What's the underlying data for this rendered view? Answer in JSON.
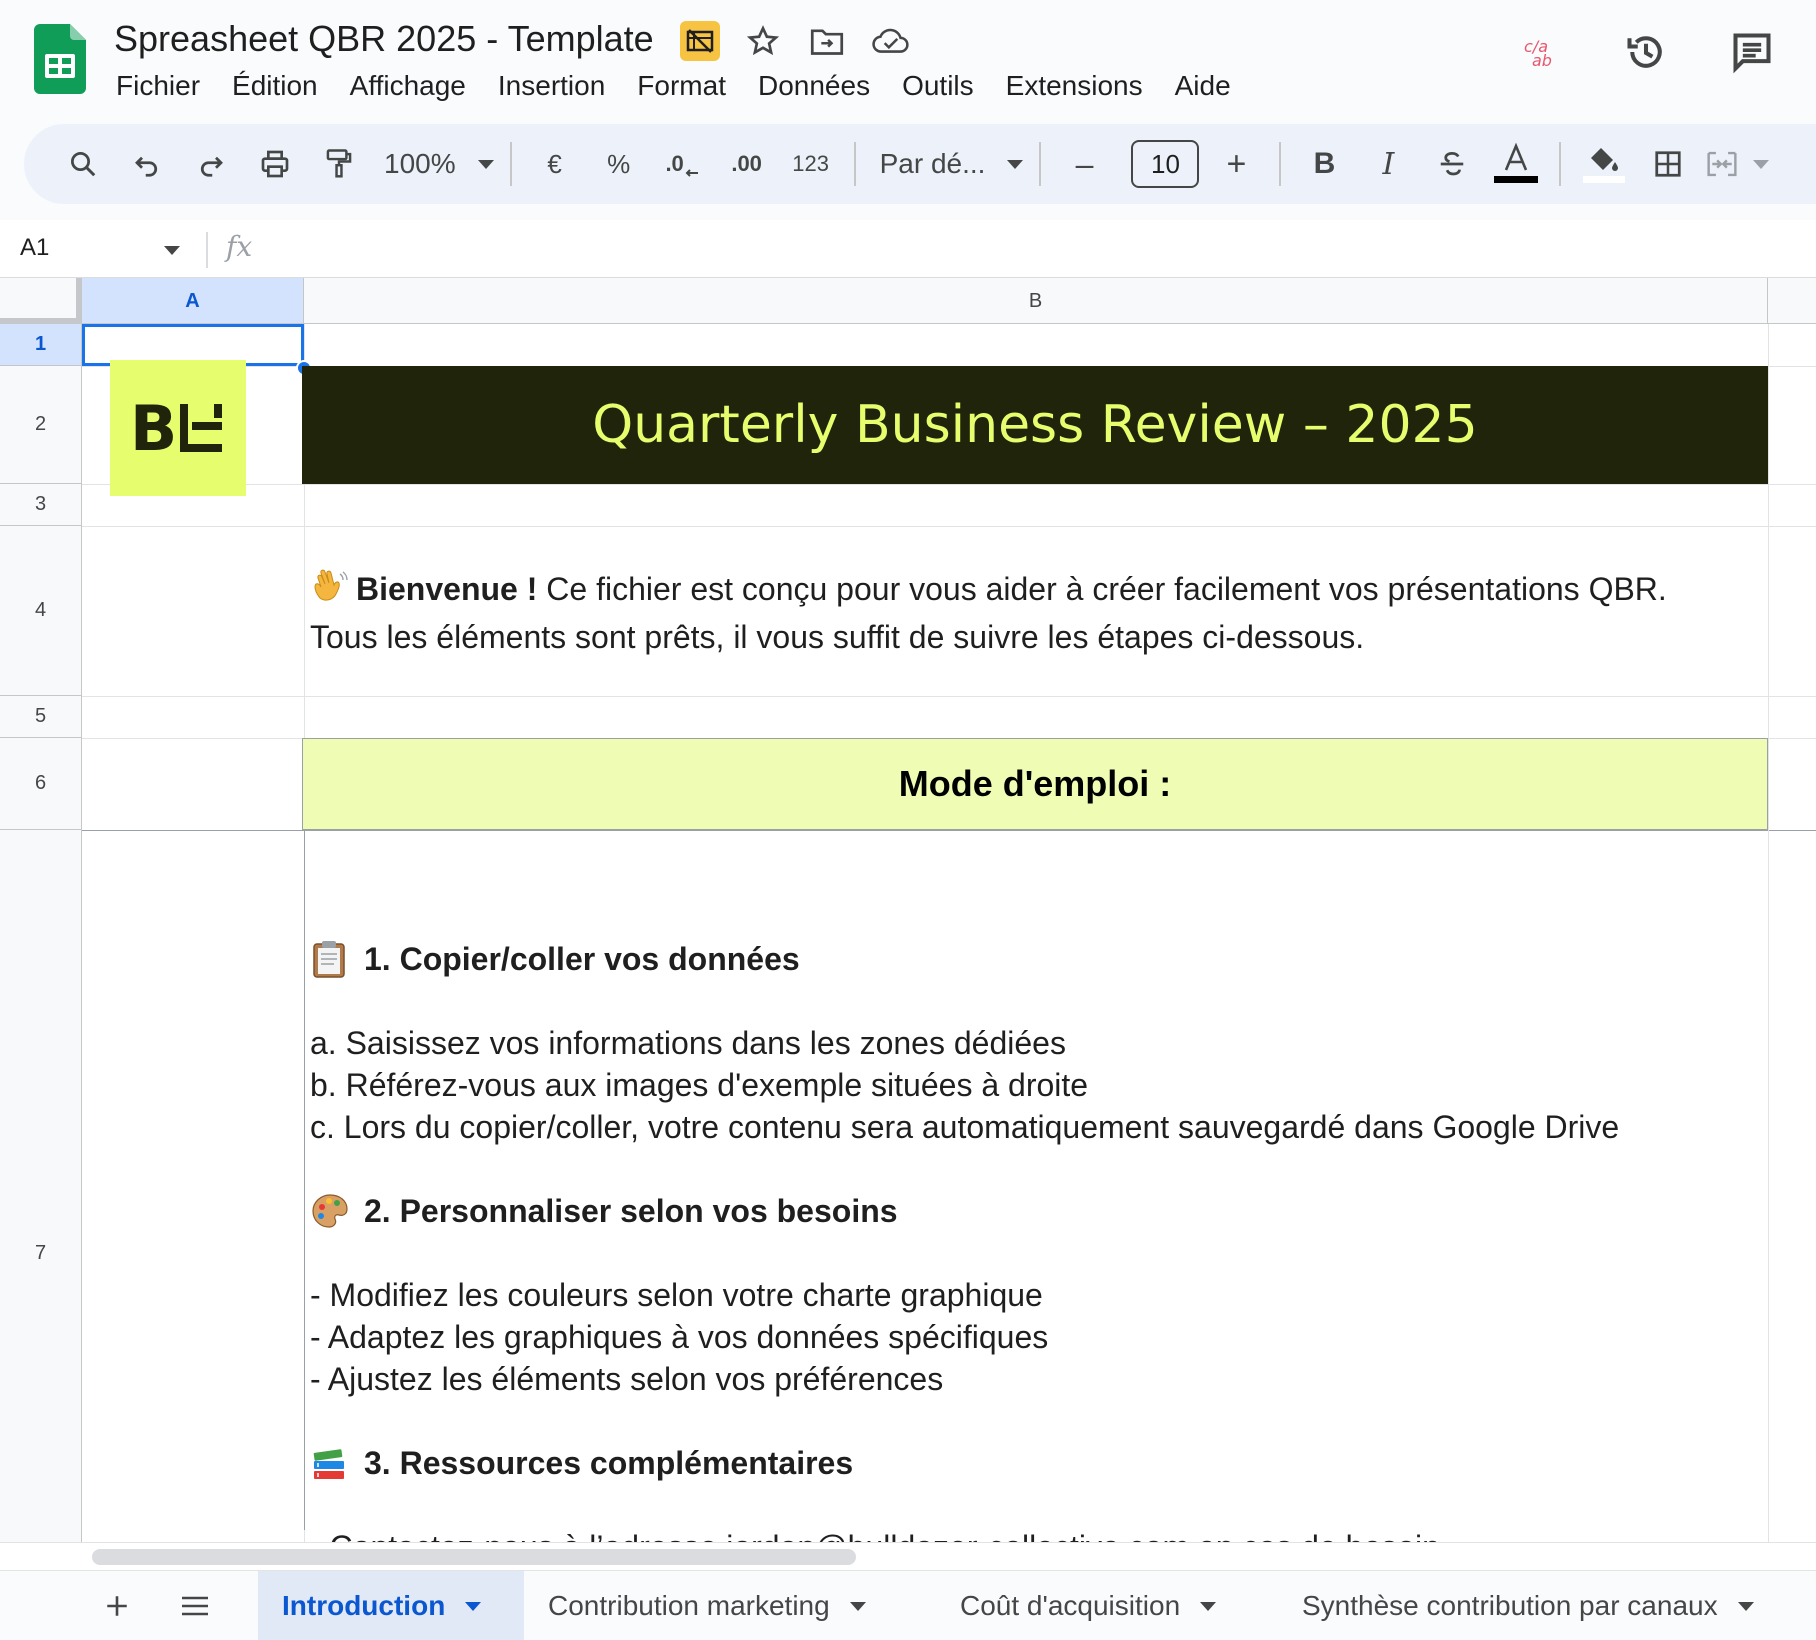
{
  "header": {
    "doc_title": "Spreasheet QBR 2025 - Template",
    "menu": [
      "Fichier",
      "Édition",
      "Affichage",
      "Insertion",
      "Format",
      "Données",
      "Outils",
      "Extensions",
      "Aide"
    ]
  },
  "toolbar": {
    "zoom": "100%",
    "currency": "€",
    "percent": "%",
    "decrease_decimals": ".0",
    "increase_decimals": ".00",
    "number_format": "123",
    "font": "Par dé...",
    "font_size": "10",
    "minus": "–",
    "plus": "+",
    "bold": "B",
    "italic": "I"
  },
  "formula_bar": {
    "cell_ref": "A1",
    "fx": "fx"
  },
  "grid": {
    "columns": [
      "A",
      "B"
    ],
    "rows": [
      "1",
      "2",
      "3",
      "4",
      "5",
      "6",
      "7"
    ],
    "logo_text": "B",
    "title": "Quarterly Business Review – 2025",
    "welcome_bold": "Bienvenue !",
    "welcome_line1": " Ce fichier est conçu pour vous aider à créer facilement vos présentations QBR.",
    "welcome_line2": "Tous les éléments sont prêts, il vous suffit de suivre les étapes ci-dessous.",
    "mode_title": "Mode d'emploi :",
    "section1_title": "1. Copier/coller vos données",
    "section1_items": [
      "a. Saisissez vos informations dans les zones dédiées",
      "b. Référez-vous aux images d'exemple situées à droite",
      "c. Lors du copier/coller, votre contenu sera automatiquement sauvegardé dans Google Drive"
    ],
    "section2_title": "2. Personnaliser selon vos besoins",
    "section2_items": [
      "- Modifiez les couleurs selon votre charte graphique",
      "- Adaptez les graphiques à vos données spécifiques",
      "- Ajustez les éléments selon vos préférences"
    ],
    "section3_title": "3. Ressources complémentaires",
    "contact_prefix": "- Contactez-nous à l’adresse ",
    "contact_email": "jordan@bulldozer-collective.com",
    "contact_suffix": " en cas de besoin"
  },
  "tabs": [
    {
      "label": "Introduction",
      "active": true
    },
    {
      "label": "Contribution marketing",
      "active": false
    },
    {
      "label": "Coût d'acquisition",
      "active": false
    },
    {
      "label": "Synthèse contribution par canaux",
      "active": false
    }
  ],
  "colors": {
    "brand_lime": "#e6fd6e",
    "banner_dark": "#1f240b",
    "mode_bg": "#effdb4",
    "selection": "#1a73e8"
  }
}
